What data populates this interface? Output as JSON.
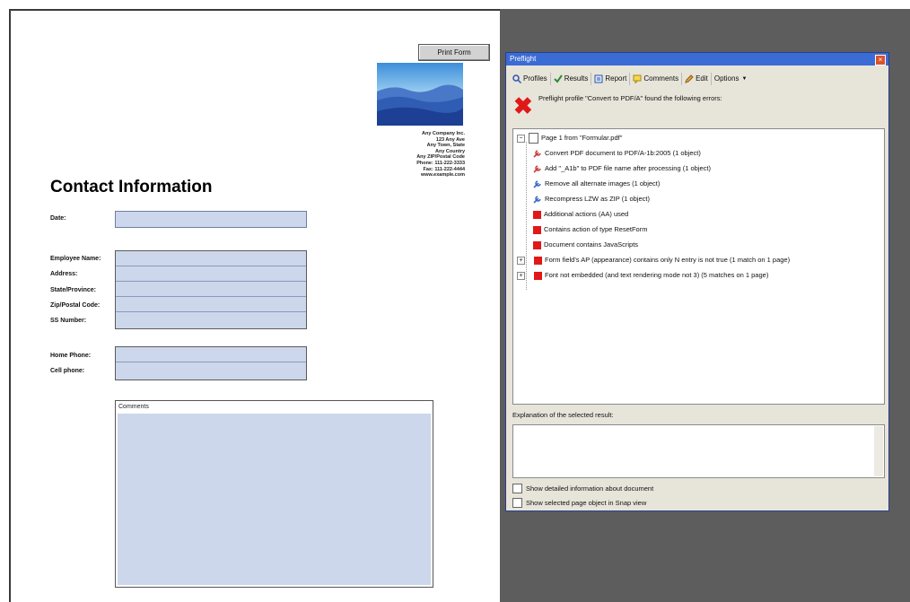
{
  "form": {
    "print_button": "Print Form",
    "company": {
      "lines": [
        "Any Company Inc.",
        "123 Any Ave",
        "Any Town, State",
        "Any Country",
        "Any ZIP/Postal Code",
        "Phone: 111-222-3333",
        "Fax: 111-222-4444",
        "www.example.com"
      ]
    },
    "title": "Contact Information",
    "labels": {
      "date": "Date:",
      "employee_name": "Employee Name:",
      "address": "Address:",
      "state": "State/Province:",
      "zip": "Zip/Postal Code:",
      "ss": "SS Number:",
      "home_phone": "Home Phone:",
      "cell_phone": "Cell phone:",
      "comments": "Comments"
    }
  },
  "preflight": {
    "title": "Preflight",
    "toolbar": {
      "profiles": "Profiles",
      "results": "Results",
      "report": "Report",
      "comments": "Comments",
      "edit": "Edit",
      "options": "Options"
    },
    "message": "Preflight profile \"Convert to PDF/A\" found the following errors:",
    "page_node": "Page 1 from \"Formular.pdf\"",
    "fixups": [
      "Convert PDF document to PDF/A-1b:2005 (1 object)",
      "Add \"_A1b\" to PDF file name after processing (1 object)",
      "Remove all alternate images (1 object)",
      "Recompress LZW as ZIP  (1 object)"
    ],
    "errors": [
      "Additional actions (AA) used",
      "Contains action of type ResetForm",
      "Document contains JavaScripts"
    ],
    "expandable_errors": [
      "Form field's AP (appearance) contains only N entry is not true (1 match on 1 page)",
      "Font not embedded (and text rendering mode not 3) (5 matches on 1 page)"
    ],
    "explanation_label": "Explanation of the selected result:",
    "checkbox_detail": "Show detailed information about document",
    "checkbox_snap": "Show selected page object in Snap view"
  }
}
